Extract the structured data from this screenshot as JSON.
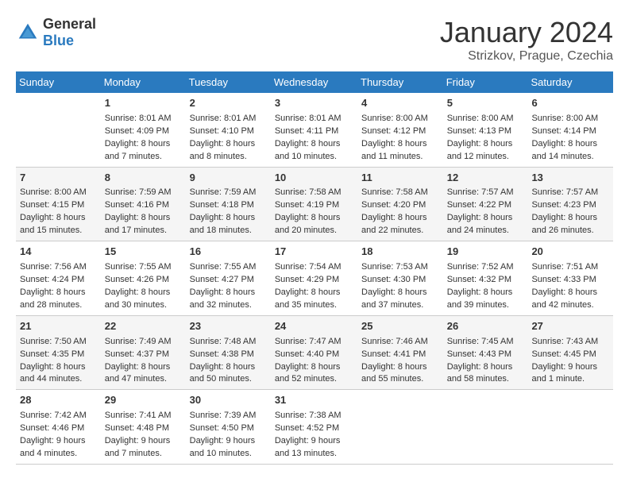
{
  "logo": {
    "general": "General",
    "blue": "Blue"
  },
  "title": "January 2024",
  "location": "Strizkov, Prague, Czechia",
  "days_of_week": [
    "Sunday",
    "Monday",
    "Tuesday",
    "Wednesday",
    "Thursday",
    "Friday",
    "Saturday"
  ],
  "weeks": [
    [
      {
        "day": "",
        "sunrise": "",
        "sunset": "",
        "daylight": ""
      },
      {
        "day": "1",
        "sunrise": "Sunrise: 8:01 AM",
        "sunset": "Sunset: 4:09 PM",
        "daylight": "Daylight: 8 hours and 7 minutes."
      },
      {
        "day": "2",
        "sunrise": "Sunrise: 8:01 AM",
        "sunset": "Sunset: 4:10 PM",
        "daylight": "Daylight: 8 hours and 8 minutes."
      },
      {
        "day": "3",
        "sunrise": "Sunrise: 8:01 AM",
        "sunset": "Sunset: 4:11 PM",
        "daylight": "Daylight: 8 hours and 10 minutes."
      },
      {
        "day": "4",
        "sunrise": "Sunrise: 8:00 AM",
        "sunset": "Sunset: 4:12 PM",
        "daylight": "Daylight: 8 hours and 11 minutes."
      },
      {
        "day": "5",
        "sunrise": "Sunrise: 8:00 AM",
        "sunset": "Sunset: 4:13 PM",
        "daylight": "Daylight: 8 hours and 12 minutes."
      },
      {
        "day": "6",
        "sunrise": "Sunrise: 8:00 AM",
        "sunset": "Sunset: 4:14 PM",
        "daylight": "Daylight: 8 hours and 14 minutes."
      }
    ],
    [
      {
        "day": "7",
        "sunrise": "Sunrise: 8:00 AM",
        "sunset": "Sunset: 4:15 PM",
        "daylight": "Daylight: 8 hours and 15 minutes."
      },
      {
        "day": "8",
        "sunrise": "Sunrise: 7:59 AM",
        "sunset": "Sunset: 4:16 PM",
        "daylight": "Daylight: 8 hours and 17 minutes."
      },
      {
        "day": "9",
        "sunrise": "Sunrise: 7:59 AM",
        "sunset": "Sunset: 4:18 PM",
        "daylight": "Daylight: 8 hours and 18 minutes."
      },
      {
        "day": "10",
        "sunrise": "Sunrise: 7:58 AM",
        "sunset": "Sunset: 4:19 PM",
        "daylight": "Daylight: 8 hours and 20 minutes."
      },
      {
        "day": "11",
        "sunrise": "Sunrise: 7:58 AM",
        "sunset": "Sunset: 4:20 PM",
        "daylight": "Daylight: 8 hours and 22 minutes."
      },
      {
        "day": "12",
        "sunrise": "Sunrise: 7:57 AM",
        "sunset": "Sunset: 4:22 PM",
        "daylight": "Daylight: 8 hours and 24 minutes."
      },
      {
        "day": "13",
        "sunrise": "Sunrise: 7:57 AM",
        "sunset": "Sunset: 4:23 PM",
        "daylight": "Daylight: 8 hours and 26 minutes."
      }
    ],
    [
      {
        "day": "14",
        "sunrise": "Sunrise: 7:56 AM",
        "sunset": "Sunset: 4:24 PM",
        "daylight": "Daylight: 8 hours and 28 minutes."
      },
      {
        "day": "15",
        "sunrise": "Sunrise: 7:55 AM",
        "sunset": "Sunset: 4:26 PM",
        "daylight": "Daylight: 8 hours and 30 minutes."
      },
      {
        "day": "16",
        "sunrise": "Sunrise: 7:55 AM",
        "sunset": "Sunset: 4:27 PM",
        "daylight": "Daylight: 8 hours and 32 minutes."
      },
      {
        "day": "17",
        "sunrise": "Sunrise: 7:54 AM",
        "sunset": "Sunset: 4:29 PM",
        "daylight": "Daylight: 8 hours and 35 minutes."
      },
      {
        "day": "18",
        "sunrise": "Sunrise: 7:53 AM",
        "sunset": "Sunset: 4:30 PM",
        "daylight": "Daylight: 8 hours and 37 minutes."
      },
      {
        "day": "19",
        "sunrise": "Sunrise: 7:52 AM",
        "sunset": "Sunset: 4:32 PM",
        "daylight": "Daylight: 8 hours and 39 minutes."
      },
      {
        "day": "20",
        "sunrise": "Sunrise: 7:51 AM",
        "sunset": "Sunset: 4:33 PM",
        "daylight": "Daylight: 8 hours and 42 minutes."
      }
    ],
    [
      {
        "day": "21",
        "sunrise": "Sunrise: 7:50 AM",
        "sunset": "Sunset: 4:35 PM",
        "daylight": "Daylight: 8 hours and 44 minutes."
      },
      {
        "day": "22",
        "sunrise": "Sunrise: 7:49 AM",
        "sunset": "Sunset: 4:37 PM",
        "daylight": "Daylight: 8 hours and 47 minutes."
      },
      {
        "day": "23",
        "sunrise": "Sunrise: 7:48 AM",
        "sunset": "Sunset: 4:38 PM",
        "daylight": "Daylight: 8 hours and 50 minutes."
      },
      {
        "day": "24",
        "sunrise": "Sunrise: 7:47 AM",
        "sunset": "Sunset: 4:40 PM",
        "daylight": "Daylight: 8 hours and 52 minutes."
      },
      {
        "day": "25",
        "sunrise": "Sunrise: 7:46 AM",
        "sunset": "Sunset: 4:41 PM",
        "daylight": "Daylight: 8 hours and 55 minutes."
      },
      {
        "day": "26",
        "sunrise": "Sunrise: 7:45 AM",
        "sunset": "Sunset: 4:43 PM",
        "daylight": "Daylight: 8 hours and 58 minutes."
      },
      {
        "day": "27",
        "sunrise": "Sunrise: 7:43 AM",
        "sunset": "Sunset: 4:45 PM",
        "daylight": "Daylight: 9 hours and 1 minute."
      }
    ],
    [
      {
        "day": "28",
        "sunrise": "Sunrise: 7:42 AM",
        "sunset": "Sunset: 4:46 PM",
        "daylight": "Daylight: 9 hours and 4 minutes."
      },
      {
        "day": "29",
        "sunrise": "Sunrise: 7:41 AM",
        "sunset": "Sunset: 4:48 PM",
        "daylight": "Daylight: 9 hours and 7 minutes."
      },
      {
        "day": "30",
        "sunrise": "Sunrise: 7:39 AM",
        "sunset": "Sunset: 4:50 PM",
        "daylight": "Daylight: 9 hours and 10 minutes."
      },
      {
        "day": "31",
        "sunrise": "Sunrise: 7:38 AM",
        "sunset": "Sunset: 4:52 PM",
        "daylight": "Daylight: 9 hours and 13 minutes."
      },
      {
        "day": "",
        "sunrise": "",
        "sunset": "",
        "daylight": ""
      },
      {
        "day": "",
        "sunrise": "",
        "sunset": "",
        "daylight": ""
      },
      {
        "day": "",
        "sunrise": "",
        "sunset": "",
        "daylight": ""
      }
    ]
  ]
}
